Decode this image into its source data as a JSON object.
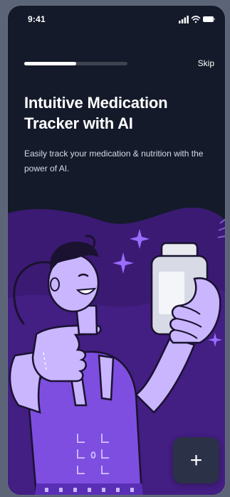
{
  "status_bar": {
    "time": "9:41",
    "icons": [
      "signal-icon",
      "wifi-icon",
      "battery-icon"
    ]
  },
  "onboarding": {
    "progress": 0.5,
    "skip_label": "Skip",
    "title": "Intuitive Medication Tracker with AI",
    "subtitle": "Easily track your medication & nutrition with the power of AI.",
    "add_button_symbol": "+"
  },
  "colors": {
    "background": "#141a2a",
    "wave_purple": "#3b1a74",
    "accent_purple": "#7e4ee0",
    "light_purple": "#c9b6ff",
    "button_bg": "#2b3146"
  }
}
